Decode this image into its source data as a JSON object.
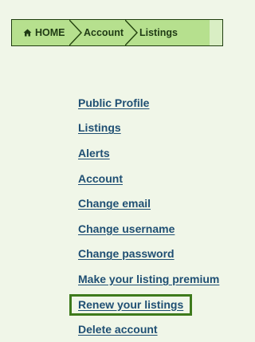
{
  "breadcrumb": {
    "home_label": "HOME",
    "home_icon": "home-icon",
    "account_label": "Account",
    "listings_label": "Listings"
  },
  "menu": {
    "items": [
      {
        "label": "Public Profile"
      },
      {
        "label": "Listings"
      },
      {
        "label": "Alerts"
      },
      {
        "label": "Account"
      },
      {
        "label": "Change email"
      },
      {
        "label": "Change username"
      },
      {
        "label": "Change password"
      },
      {
        "label": "Make your listing premium"
      },
      {
        "label": "Renew your listings",
        "active": true
      },
      {
        "label": "Delete account"
      }
    ]
  },
  "colors": {
    "background": "#f0f6e8",
    "crumb_fill": "#b6e08e",
    "border_dark_green": "#1f3d0f",
    "link_blue": "#1f4f73",
    "active_frame": "#3e7a1c"
  }
}
